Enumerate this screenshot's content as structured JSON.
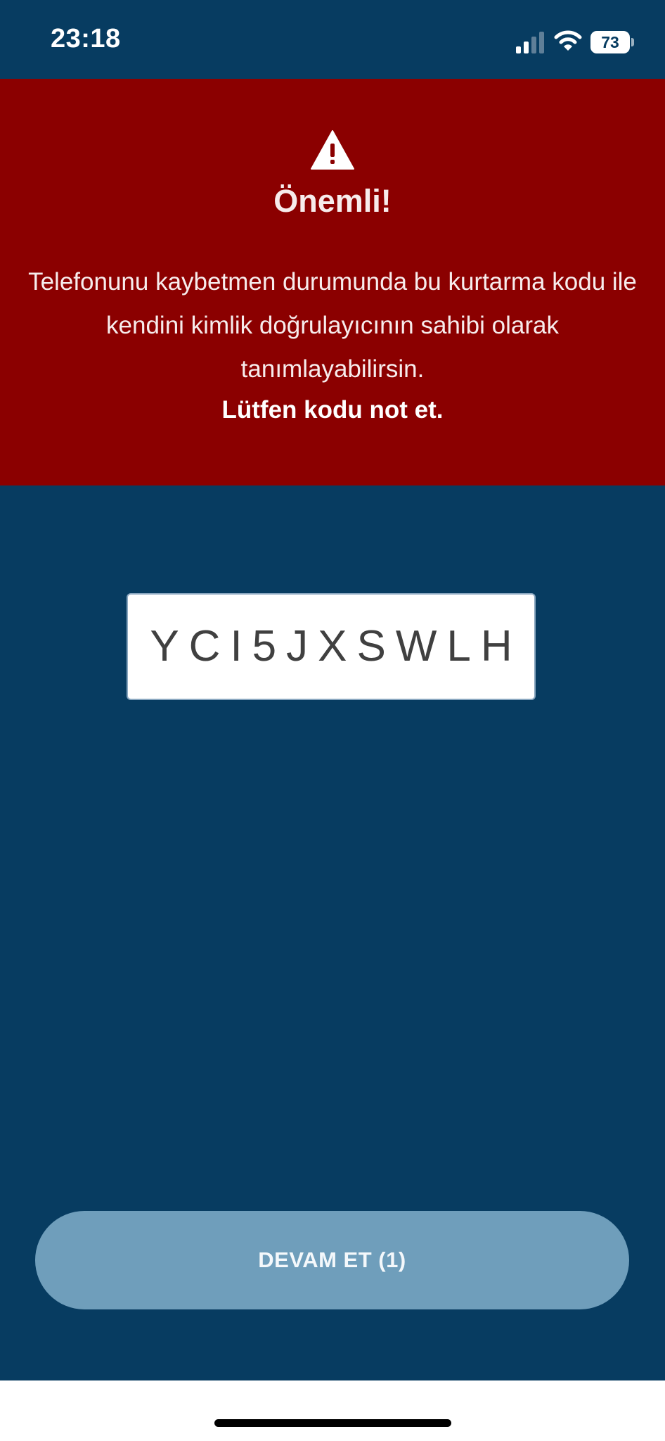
{
  "status_bar": {
    "time": "23:18",
    "battery_level": "73",
    "icons": [
      "signal-icon",
      "wifi-icon",
      "battery-icon"
    ]
  },
  "warning": {
    "icon": "warning-icon",
    "title": "Önemli!",
    "message": "Telefonunu kaybetmen durumunda bu kurtarma kodu ile kendini kimlik doğrulayıcının sahibi olarak tanımlayabilirsin.",
    "emphasis": "Lütfen kodu not et."
  },
  "recovery_code": "YCI5JXSWLH",
  "continue_button": {
    "label": "DEVAM ET (1)"
  },
  "colors": {
    "background": "#073c61",
    "warning_background": "#8b0000",
    "button_background": "#6f9ebb",
    "code_box_background": "#ffffff"
  }
}
